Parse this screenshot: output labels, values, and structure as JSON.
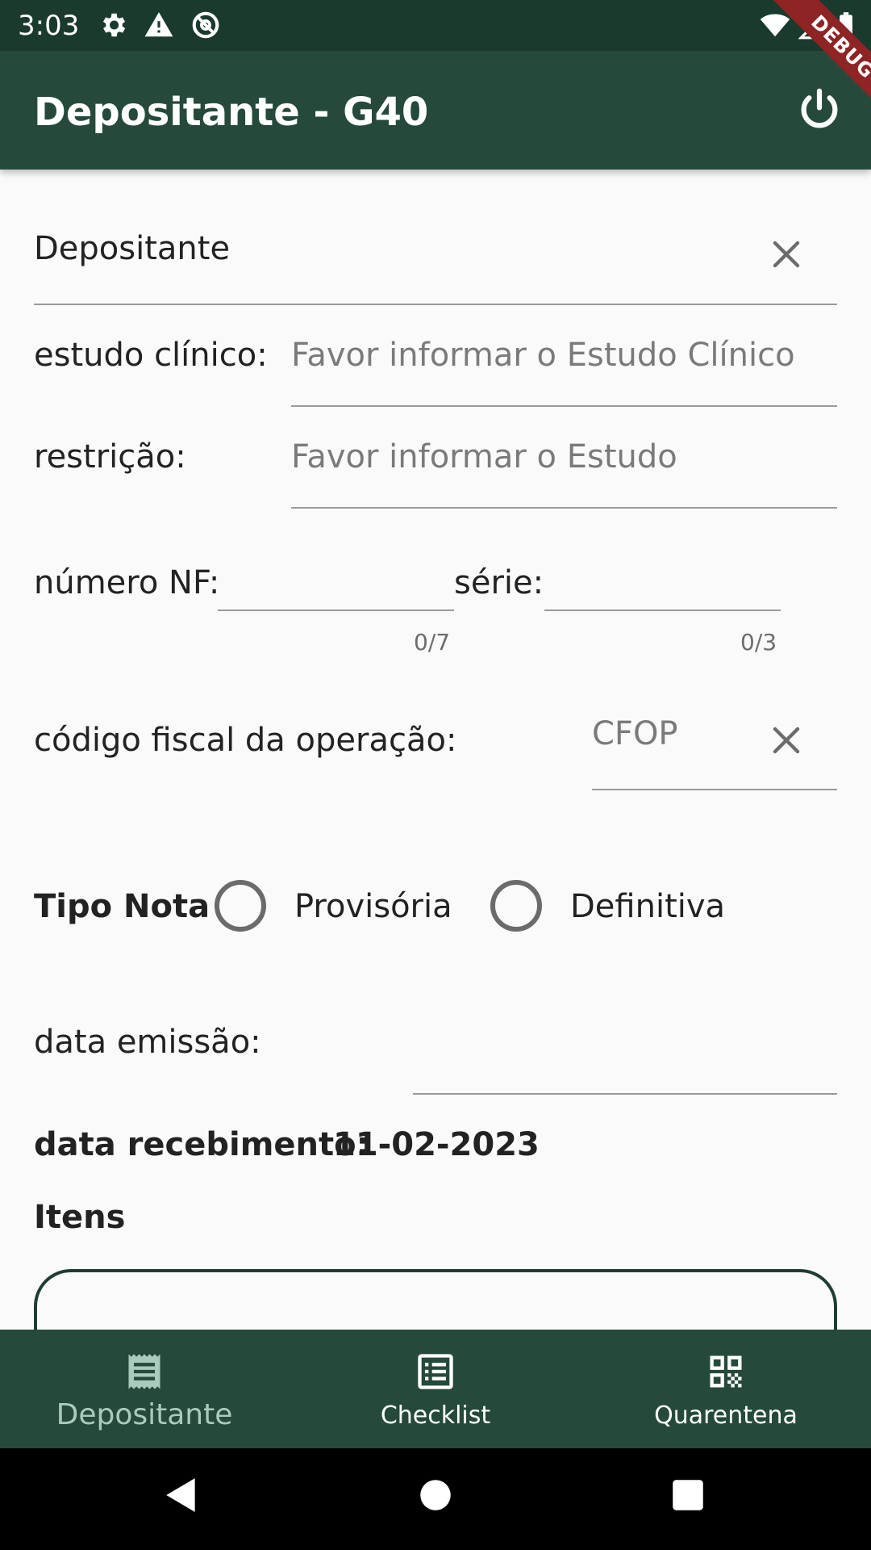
{
  "status_bar": {
    "time": "3:03",
    "icons": [
      "gear-icon",
      "warning-icon",
      "at-sign-icon",
      "wifi-icon",
      "signal-icon",
      "battery-icon"
    ]
  },
  "debug_banner": "DEBUG",
  "app_bar": {
    "title": "Depositante - G40",
    "power_icon": "power-icon"
  },
  "form": {
    "depositante": {
      "value": "Depositante"
    },
    "estudo_clinico": {
      "label": "estudo clínico:",
      "placeholder": "Favor informar o Estudo Clínico"
    },
    "restricao": {
      "label": "restrição:",
      "placeholder": "Favor informar o Estudo"
    },
    "numero_nf": {
      "label": "número NF:",
      "counter": "0/7"
    },
    "serie": {
      "label": "série:",
      "counter": "0/3"
    },
    "cfop": {
      "label": "código fiscal da operação:",
      "placeholder": "CFOP"
    },
    "tipo_nota": {
      "label": "Tipo Nota",
      "options": [
        "Provisória",
        "Definitiva"
      ]
    },
    "data_emissao": {
      "label": "data emissão:"
    },
    "data_recebimento": {
      "label": "data recebimento:",
      "value": "11-02-2023"
    },
    "itens_label": "Itens"
  },
  "bottom_nav": {
    "items": [
      {
        "label": "Depositante",
        "icon": "receipt-icon",
        "active": true
      },
      {
        "label": "Checklist",
        "icon": "checklist-icon",
        "active": false
      },
      {
        "label": "Quarentena",
        "icon": "qr-code-icon",
        "active": false
      }
    ]
  },
  "colors": {
    "primary": "#254a3b",
    "status_bar": "#1b3a2e",
    "nav_active": "#a8cbbd",
    "debug_ribbon": "#8e2424"
  }
}
